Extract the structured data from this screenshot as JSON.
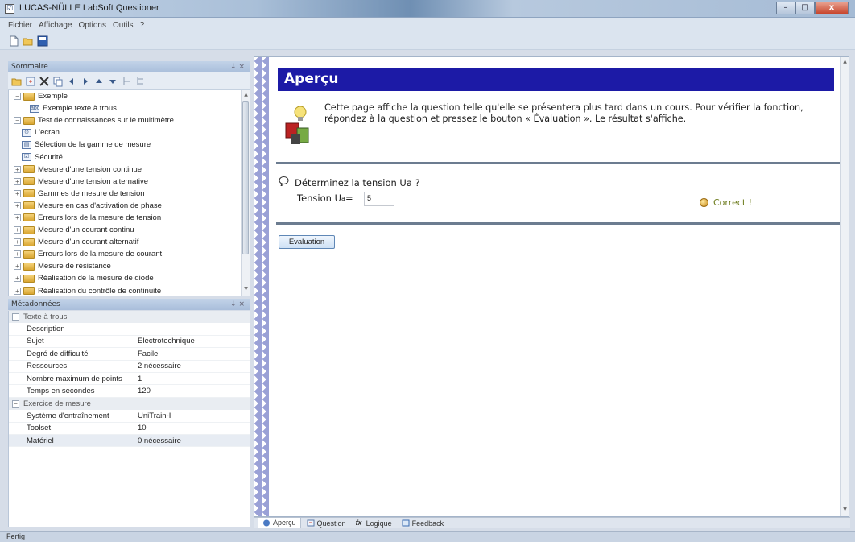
{
  "window": {
    "title": "LUCAS-NÜLLE LabSoft Questioner",
    "min": "–",
    "max": "□",
    "close": "x"
  },
  "menu": [
    "Fichier",
    "Affichage",
    "Options",
    "Outils",
    "?"
  ],
  "sommaire": {
    "title": "Sommaire",
    "pin": "↓ ×",
    "tree": [
      {
        "label": "Exemple",
        "level": 0,
        "type": "folder",
        "expander": "−"
      },
      {
        "label": "Exemple texte à trous",
        "level": 2,
        "type": "leaf",
        "icon": "abc"
      },
      {
        "label": "Test de connaissances sur le multimètre",
        "level": 0,
        "type": "folder",
        "expander": "−"
      },
      {
        "label": "L'ecran",
        "level": 1,
        "type": "leaf",
        "icon": "⊙"
      },
      {
        "label": "Sélection de la gamme de mesure",
        "level": 1,
        "type": "leaf",
        "icon": "▤"
      },
      {
        "label": "Sécurité",
        "level": 1,
        "type": "leaf",
        "icon": "☑"
      },
      {
        "label": "Mesure d'une tension continue",
        "level": 0,
        "type": "folder",
        "expander": "+"
      },
      {
        "label": "Mesure d'une tension alternative",
        "level": 0,
        "type": "folder",
        "expander": "+"
      },
      {
        "label": "Gammes de mesure de tension",
        "level": 0,
        "type": "folder",
        "expander": "+"
      },
      {
        "label": "Mesure en cas d'activation de phase",
        "level": 0,
        "type": "folder",
        "expander": "+"
      },
      {
        "label": "Erreurs lors de la mesure de tension",
        "level": 0,
        "type": "folder",
        "expander": "+"
      },
      {
        "label": "Mesure d'un courant continu",
        "level": 0,
        "type": "folder",
        "expander": "+"
      },
      {
        "label": "Mesure d'un courant alternatif",
        "level": 0,
        "type": "folder",
        "expander": "+"
      },
      {
        "label": "Erreurs lors de la mesure de courant",
        "level": 0,
        "type": "folder",
        "expander": "+"
      },
      {
        "label": "Mesure de résistance",
        "level": 0,
        "type": "folder",
        "expander": "+"
      },
      {
        "label": "Réalisation de la mesure de diode",
        "level": 0,
        "type": "folder",
        "expander": "+"
      },
      {
        "label": "Réalisation du contrôle de continuité",
        "level": 0,
        "type": "folder",
        "expander": "+"
      }
    ]
  },
  "metadonnees": {
    "title": "Métadonnées",
    "pin": "↓ ×",
    "cat1": "Texte à trous",
    "rows1": [
      {
        "k": "Description",
        "v": ""
      },
      {
        "k": "Sujet",
        "v": "Électrotechnique"
      },
      {
        "k": "Degré de difficulté",
        "v": "Facile"
      },
      {
        "k": "Ressources",
        "v": "2 nécessaire"
      },
      {
        "k": "Nombre maximum de points",
        "v": "1"
      },
      {
        "k": "Temps en secondes",
        "v": "120"
      }
    ],
    "cat2": "Exercice de mesure",
    "rows2": [
      {
        "k": "Système d'entraînement",
        "v": "UniTrain-I"
      },
      {
        "k": "Toolset",
        "v": "10"
      },
      {
        "k": "Matériel",
        "v": "0 nécessaire"
      }
    ],
    "dots": "..."
  },
  "preview": {
    "header": "Aperçu",
    "info": "Cette page affiche la question telle qu'elle se présentera plus tard dans un cours. Pour vérifier la fonction, répondez à la question et pressez le bouton « Évaluation ». Le résultat s'affiche.",
    "question": "Déterminez la tension Ua ?",
    "formula_prefix": "Tension U",
    "formula_sub": "a",
    "formula_eq": " = ",
    "answer": "5",
    "result": "Correct !",
    "eval_button": "Évaluation"
  },
  "tabs": [
    "Aperçu",
    "Question",
    "Logique",
    "Feedback"
  ],
  "status": "Fertig",
  "colors": {
    "header_bg": "#1c1aa6",
    "correct": "#6b7a1a",
    "zigzag": "#9aa1d6"
  }
}
